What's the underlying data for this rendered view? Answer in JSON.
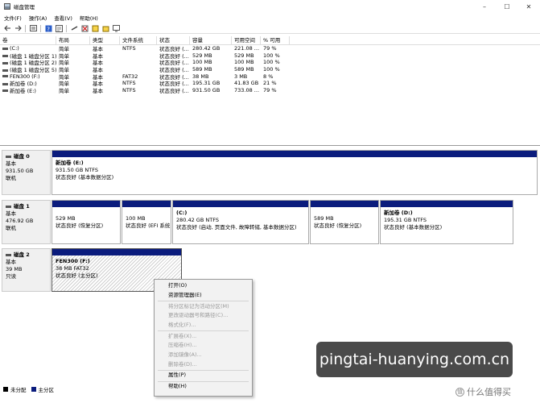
{
  "window": {
    "title": "磁盘管理",
    "controls": {
      "minimize": "–",
      "maximize": "☐",
      "close": "✕"
    }
  },
  "menu": [
    "文件(F)",
    "操作(A)",
    "查看(V)",
    "帮助(H)"
  ],
  "toolbar_icons": [
    "back-arrow-icon",
    "forward-arrow-icon",
    "list-view-icon",
    "help-icon",
    "properties-icon",
    "connect-icon",
    "delete-icon",
    "check-icon",
    "folder-icon",
    "monitor-icon"
  ],
  "volume_list": {
    "headers": [
      "卷",
      "布局",
      "类型",
      "文件系统",
      "状态",
      "容量",
      "可用空间",
      "% 可用"
    ],
    "rows": [
      [
        "(C:)",
        "简单",
        "基本",
        "NTFS",
        "状态良好 (...",
        "280.42 GB",
        "221.08 ...",
        "79 %"
      ],
      [
        "(磁盘 1 磁盘分区 1)",
        "简单",
        "基本",
        "",
        "状态良好 (...",
        "529 MB",
        "529 MB",
        "100 %"
      ],
      [
        "(磁盘 1 磁盘分区 2)",
        "简单",
        "基本",
        "",
        "状态良好 (...",
        "100 MB",
        "100 MB",
        "100 %"
      ],
      [
        "(磁盘 1 磁盘分区 5)",
        "简单",
        "基本",
        "",
        "状态良好 (...",
        "589 MB",
        "589 MB",
        "100 %"
      ],
      [
        "FEN300 (F:)",
        "简单",
        "基本",
        "FAT32",
        "状态良好 (...",
        "38 MB",
        "3 MB",
        "8 %"
      ],
      [
        "新加卷 (D:)",
        "简单",
        "基本",
        "NTFS",
        "状态良好 (...",
        "195.31 GB",
        "41.83 GB",
        "21 %"
      ],
      [
        "新加卷 (E:)",
        "简单",
        "基本",
        "NTFS",
        "状态良好 (...",
        "931.50 GB",
        "733.08 ...",
        "79 %"
      ]
    ]
  },
  "disks": [
    {
      "name": "磁盘 0",
      "type": "基本",
      "size": "931.50 GB",
      "status": "联机",
      "partitions": [
        {
          "name": "新加卷 (E:)",
          "size": "931.50 GB NTFS",
          "status": "状态良好 (基本数据分区)"
        }
      ]
    },
    {
      "name": "磁盘 1",
      "type": "基本",
      "size": "476.92 GB",
      "status": "联机",
      "partitions": [
        {
          "name": "",
          "size": "529 MB",
          "status": "状态良好 (恢复分区)"
        },
        {
          "name": "",
          "size": "100 MB",
          "status": "状态良好 (EFI 系统"
        },
        {
          "name": "(C:)",
          "size": "280.42 GB NTFS",
          "status": "状态良好 (启动, 页面文件, 故障转储, 基本数据分区)"
        },
        {
          "name": "",
          "size": "589 MB",
          "status": "状态良好 (恢复分区)"
        },
        {
          "name": "新加卷 (D:)",
          "size": "195.31 GB NTFS",
          "status": "状态良好 (基本数据分区)"
        }
      ]
    },
    {
      "name": "磁盘 2",
      "type": "基本",
      "size": "39 MB",
      "status": "只读",
      "partitions": [
        {
          "name": "FEN300 (F:)",
          "size": "38 MB FAT32",
          "status": "状态良好 (主分区)"
        }
      ]
    }
  ],
  "legend": [
    {
      "label": "未分配",
      "color": "#000000"
    },
    {
      "label": "主分区",
      "color": "#0b1c7d"
    }
  ],
  "context_menu": {
    "groups": [
      [
        {
          "label": "打开(O)",
          "enabled": true
        },
        {
          "label": "资源管理器(E)",
          "enabled": true
        }
      ],
      [
        {
          "label": "将分区标记为活动分区(M)",
          "enabled": false
        },
        {
          "label": "更改驱动器号和路径(C)...",
          "enabled": false
        },
        {
          "label": "格式化(F)...",
          "enabled": false
        }
      ],
      [
        {
          "label": "扩展卷(X)...",
          "enabled": false
        },
        {
          "label": "压缩卷(H)...",
          "enabled": false
        },
        {
          "label": "添加镜像(A)...",
          "enabled": false
        },
        {
          "label": "删除卷(D)...",
          "enabled": false
        }
      ],
      [
        {
          "label": "属性(P)",
          "enabled": true
        }
      ],
      [
        {
          "label": "帮助(H)",
          "enabled": true
        }
      ]
    ]
  },
  "overlay_text": "pingtai-huanying.com.cn",
  "watermark": {
    "mark": "值",
    "text": "什么值得买"
  },
  "colors": {
    "partition_bar": "#0b1c7d",
    "selected_hatch": "#d0d0d0"
  }
}
